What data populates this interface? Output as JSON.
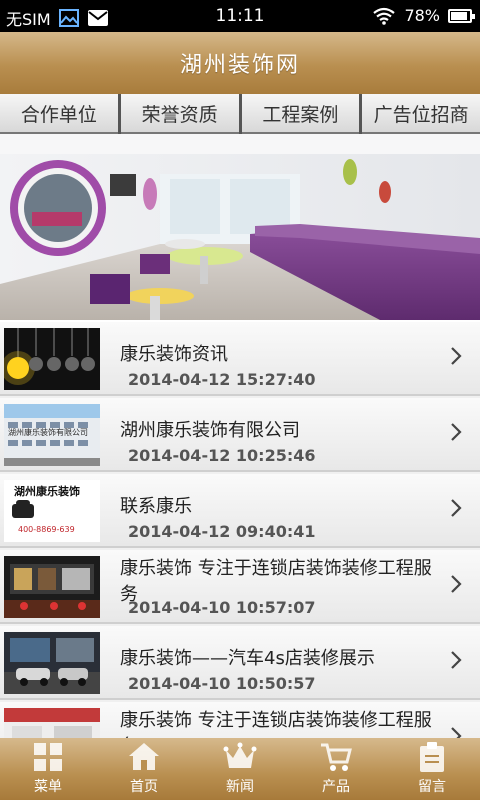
{
  "status": {
    "carrier": "无SIM",
    "time": "11:11",
    "battery": "78%",
    "battery_level": 0.78
  },
  "header": {
    "title": "湖州装饰网"
  },
  "tabs": [
    {
      "label": "合作单位"
    },
    {
      "label": "荣誉资质"
    },
    {
      "label": "工程案例"
    },
    {
      "label": "广告位招商"
    }
  ],
  "news": [
    {
      "title": "康乐装饰资讯",
      "date": "2014-04-12 15:27:40"
    },
    {
      "title": "湖州康乐装饰有限公司",
      "date": "2014-04-12 10:25:46"
    },
    {
      "title": "联系康乐",
      "date": "2014-04-12 09:40:41"
    },
    {
      "title": "康乐装饰 专注于连锁店装饰装修工程服务",
      "date": "2014-04-10 10:57:07"
    },
    {
      "title": "康乐装饰——汽车4s店装修展示",
      "date": "2014-04-10 10:50:57"
    },
    {
      "title": "康乐装饰 专注于连锁店装饰装修工程服务",
      "date": ""
    }
  ],
  "thumb_text": {
    "company_sign": "湖州康乐装饰",
    "phone": "400-8869-639",
    "building_sign": "湖州康乐装饰有限公司"
  },
  "nav": [
    {
      "label": "菜单",
      "icon": "grid-icon"
    },
    {
      "label": "首页",
      "icon": "home-icon"
    },
    {
      "label": "新闻",
      "icon": "crown-icon"
    },
    {
      "label": "产品",
      "icon": "cart-icon"
    },
    {
      "label": "留言",
      "icon": "clipboard-icon"
    }
  ],
  "colors": {
    "gold": "#b98f50",
    "purple": "#7a3f8a"
  }
}
